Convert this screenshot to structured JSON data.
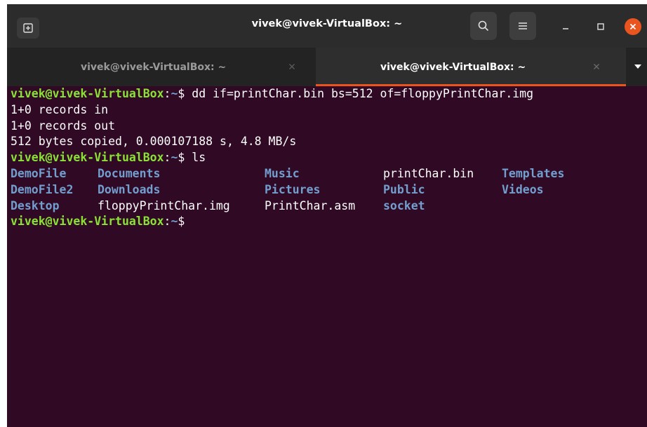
{
  "window": {
    "title": "vivek@vivek-VirtualBox: ~"
  },
  "tabs": [
    {
      "label": "vivek@vivek-VirtualBox: ~",
      "active": false
    },
    {
      "label": "vivek@vivek-VirtualBox: ~",
      "active": true
    }
  ],
  "colors": {
    "terminal_bg": "#300a24",
    "prompt_user": "#8ae234",
    "prompt_path": "#729fcf",
    "directory": "#729fcf",
    "accent": "#e9541f"
  },
  "icons": {
    "new_tab": "new-tab-icon",
    "search": "search-icon",
    "menu": "hamburger-menu-icon",
    "minimize": "minimize-icon",
    "maximize": "maximize-icon",
    "close": "close-icon",
    "tab_close": "tab-close-icon",
    "tabs_dropdown": "chevron-down-icon"
  },
  "terminal": {
    "prompt_user": "vivek@vivek-VirtualBox",
    "prompt_sep": ":",
    "prompt_path": "~",
    "prompt_symbol": "$ ",
    "command1": "dd if=printChar.bin bs=512 of=floppyPrintChar.img",
    "output1": "1+0 records in",
    "output2": "1+0 records out",
    "output3": "512 bytes copied, 0.000107188 s, 4.8 MB/s",
    "command2": "ls",
    "ls_rows": [
      [
        {
          "name": "DemoFile",
          "type": "dir"
        },
        {
          "name": "Documents",
          "type": "dir"
        },
        {
          "name": "Music",
          "type": "dir"
        },
        {
          "name": "printChar.bin",
          "type": "file"
        },
        {
          "name": "Templates",
          "type": "dir"
        }
      ],
      [
        {
          "name": "DemoFile2",
          "type": "dir"
        },
        {
          "name": "Downloads",
          "type": "dir"
        },
        {
          "name": "Pictures",
          "type": "dir"
        },
        {
          "name": "Public",
          "type": "dir"
        },
        {
          "name": "Videos",
          "type": "dir"
        }
      ],
      [
        {
          "name": "Desktop",
          "type": "dir"
        },
        {
          "name": "floppyPrintChar.img",
          "type": "file"
        },
        {
          "name": "PrintChar.asm",
          "type": "file"
        },
        {
          "name": "socket",
          "type": "dir"
        }
      ]
    ]
  }
}
